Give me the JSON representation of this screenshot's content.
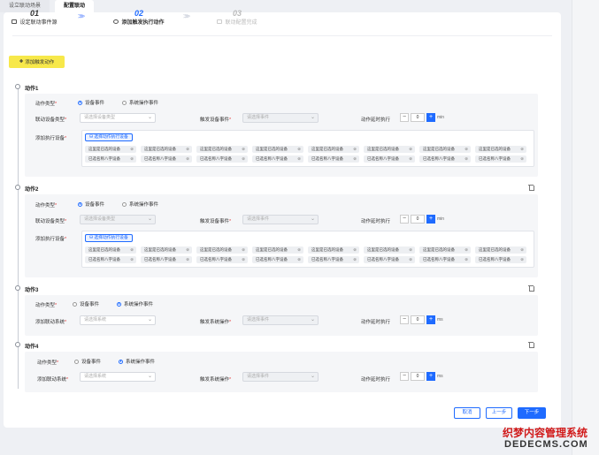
{
  "tabs": [
    {
      "label": "设立联动场景"
    },
    {
      "label": "配置联动"
    }
  ],
  "steps": [
    {
      "num": "01",
      "label": "设定联动事件源"
    },
    {
      "num": "02",
      "label": "添加触发执行动作"
    },
    {
      "num": "03",
      "label": "联动配置完成"
    }
  ],
  "add_action_label": "添加触发动作",
  "labels": {
    "action_type": "动作类型",
    "device_event": "设备事件",
    "system_event": "系统操作事件",
    "linked_device_type": "联动设备类型",
    "trigger_device_event": "触发设备事件",
    "delay_exec": "动作延时执行",
    "add_exec_device": "添加执行设备",
    "add_linked_system": "添加联动系统",
    "trigger_system_op": "触发系统操作",
    "choose_device_btn": "选择动作执行设备"
  },
  "placeholders": {
    "device_type": "请选择设备类型",
    "event": "请选择事件",
    "system": "请选择系统"
  },
  "units": {
    "min": "min",
    "ms": "ms"
  },
  "tag_labels": {
    "row1": "这里是已选的设备",
    "row2": "已选名称八字设备"
  },
  "actions": [
    {
      "title": "动作1",
      "delay": "0"
    },
    {
      "title": "动作2",
      "delay": "0"
    },
    {
      "title": "动作3",
      "delay": "0"
    },
    {
      "title": "动作4",
      "delay": "0"
    }
  ],
  "footer": {
    "cancel": "取消",
    "prev": "上一步",
    "next": "下一步"
  },
  "watermark": {
    "line1": "织梦内容管理系统",
    "line2": "DEDECMS.COM"
  },
  "colors": {
    "primary": "#1f6bff",
    "add_btn": "#f7e84a",
    "required": "#e53e3e"
  }
}
